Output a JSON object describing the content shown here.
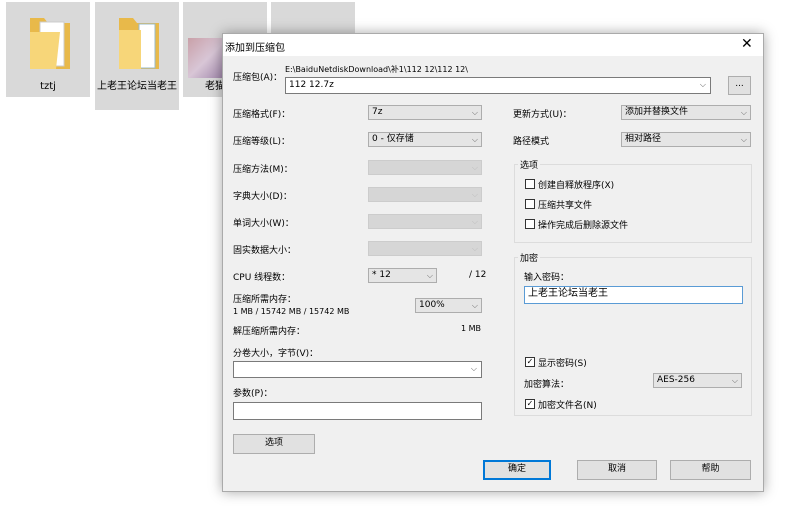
{
  "desktop": {
    "items": [
      {
        "label": "tztj"
      },
      {
        "label": "上老王论坛当老王"
      },
      {
        "label": "老猫"
      },
      {
        "label": ""
      }
    ]
  },
  "dialog": {
    "title": "添加到压缩包",
    "archive_label": "压缩包(A)：",
    "archive_path": "E:\\BaiduNetdiskDownload\\补1\\112 12\\112 12\\",
    "archive_name": "112 12.7z",
    "browse_label": "...",
    "format_label": "压缩格式(F)：",
    "format_value": "7z",
    "level_label": "压缩等级(L)：",
    "level_value": "0 - 仅存储",
    "method_label": "压缩方法(M)：",
    "dict_label": "字典大小(D)：",
    "word_label": "单词大小(W)：",
    "solid_label": "固实数据大小：",
    "cpu_label": "CPU 线程数：",
    "cpu_value": "* 12",
    "cpu_max": "/ 12",
    "mem_label": "压缩所需内存：",
    "mem_value": "1 MB / 15742 MB / 15742 MB",
    "mem_percent": "100%",
    "decomp_label": "解压缩所需内存：",
    "decomp_value": "1 MB",
    "split_label": "分卷大小，字节(V)：",
    "split_value": "",
    "params_label": "参数(P)：",
    "params_value": "",
    "options_button": "选项",
    "update_label": "更新方式(U)：",
    "update_value": "添加并替换文件",
    "path_label": "路径模式",
    "path_value": "相对路径",
    "options_group": "选项",
    "opt_sfx": "创建自释放程序(X)",
    "opt_sfx_checked": false,
    "opt_shared": "压缩共享文件",
    "opt_shared_checked": false,
    "opt_delete": "操作完成后删除源文件",
    "opt_delete_checked": false,
    "enc_group": "加密",
    "pwd_label": "输入密码：",
    "pwd_value": "上老王论坛当老王",
    "show_pwd": "显示密码(S)",
    "show_pwd_checked": true,
    "enc_method_label": "加密算法：",
    "enc_method_value": "AES-256",
    "enc_names": "加密文件名(N)",
    "enc_names_checked": true,
    "ok": "确定",
    "cancel": "取消",
    "help": "帮助"
  }
}
